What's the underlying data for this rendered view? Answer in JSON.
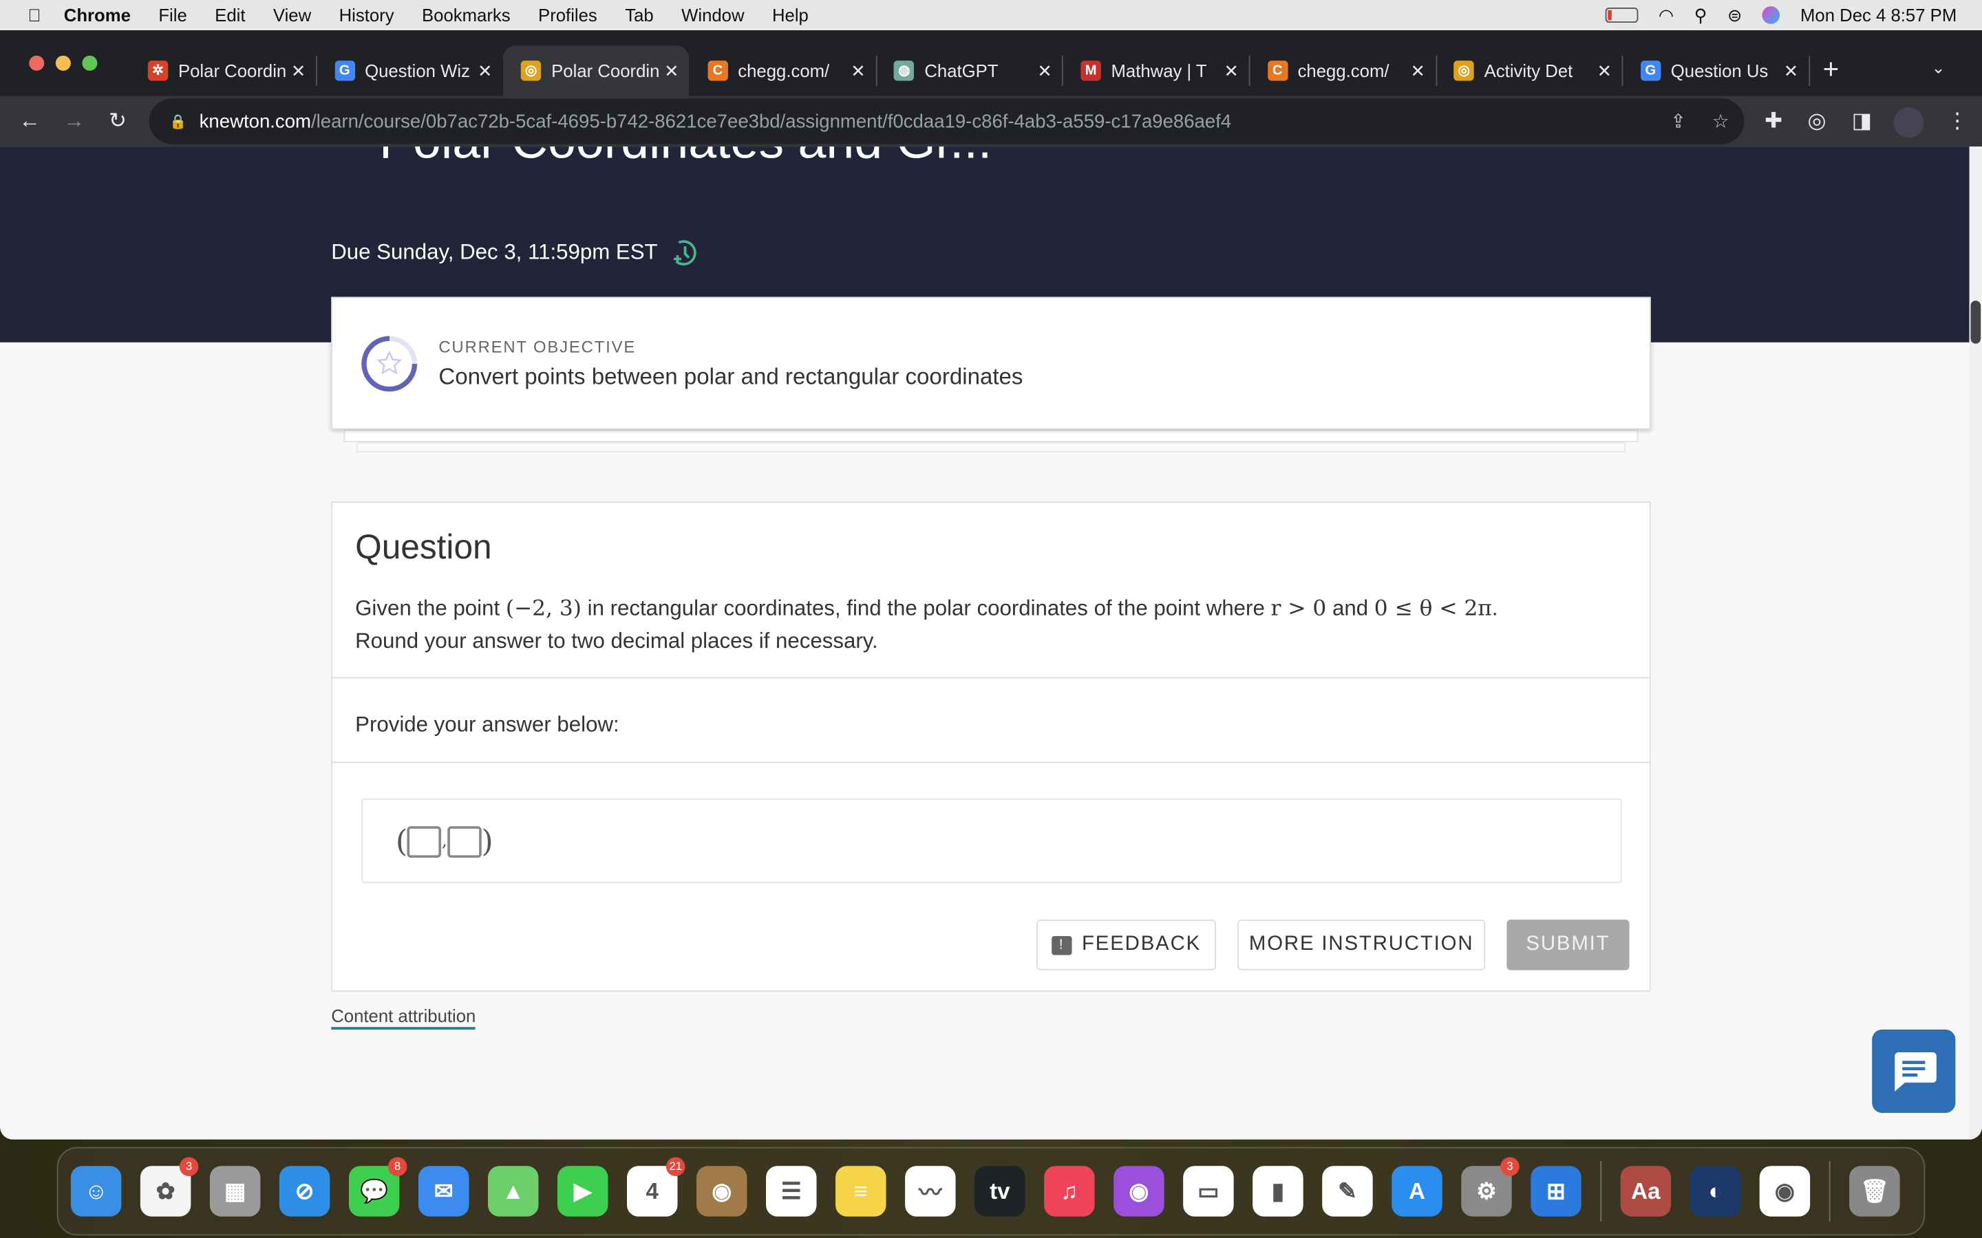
{
  "menubar": {
    "app": "Chrome",
    "items": [
      "File",
      "Edit",
      "View",
      "History",
      "Bookmarks",
      "Profiles",
      "Tab",
      "Window",
      "Help"
    ],
    "datetime": "Mon Dec 4  8:57 PM"
  },
  "tabs": [
    {
      "title": "Polar Coordinates",
      "color": "#d9402a",
      "glyph": "✲",
      "active": false
    },
    {
      "title": "Question Wiz",
      "color": "#4285f4",
      "glyph": "G",
      "active": false
    },
    {
      "title": "Polar Coordinates",
      "color": "#e0a020",
      "glyph": "◎",
      "active": true
    },
    {
      "title": "chegg.com/",
      "color": "#e87722",
      "glyph": "C",
      "active": false
    },
    {
      "title": "ChatGPT",
      "color": "#74aa9c",
      "glyph": "◍",
      "active": false
    },
    {
      "title": "Mathway | T",
      "color": "#c8312b",
      "glyph": "M",
      "active": false
    },
    {
      "title": "chegg.com/",
      "color": "#e87722",
      "glyph": "C",
      "active": false
    },
    {
      "title": "Activity Det",
      "color": "#e0a020",
      "glyph": "◎",
      "active": false
    },
    {
      "title": "Question Us",
      "color": "#4285f4",
      "glyph": "G",
      "active": false
    }
  ],
  "url": {
    "domain": "knewton.com",
    "path": "/learn/course/0b7ac72b-5caf-4695-b742-8621ce7ee3bd/assignment/f0cdaa19-c86f-4ab3-a559-c17a9e86aef4"
  },
  "header": {
    "title": "Polar Coordinates and Gr...",
    "due": "Due Sunday, Dec 3, 11:59pm EST"
  },
  "objective": {
    "label": "CURRENT OBJECTIVE",
    "text": "Convert points between polar and rectangular coordinates",
    "progress": 0.25
  },
  "question": {
    "title": "Question",
    "text_before": "Given the point ",
    "point": "(−2, 3)",
    "text_mid": " in rectangular coordinates, find the polar coordinates of the point where ",
    "cond1": "r > 0",
    "and": " and ",
    "cond2": "0 ≤ θ < 2π",
    "end": ".",
    "line2": "Round your answer to two decimal places if necessary.",
    "provide": "Provide your answer below:",
    "comma": ","
  },
  "buttons": {
    "feedback": "FEEDBACK",
    "more": "MORE INSTRUCTION",
    "submit": "SUBMIT"
  },
  "footer": {
    "attribution": "Content attribution"
  },
  "dock": [
    {
      "name": "Finder",
      "color": "#3a8ee6",
      "glyph": "☺"
    },
    {
      "name": "Photos",
      "color": "#f4f4f4",
      "glyph": "✿",
      "badge": "3"
    },
    {
      "name": "Launchpad",
      "color": "#9a9a9a",
      "glyph": "▦"
    },
    {
      "name": "Safari",
      "color": "#2f8fe8",
      "glyph": "⊘"
    },
    {
      "name": "Messages",
      "color": "#3ecf4f",
      "glyph": "💬",
      "badge": "8"
    },
    {
      "name": "Mail",
      "color": "#3b8bf0",
      "glyph": "✉"
    },
    {
      "name": "Maps",
      "color": "#6ccf6a",
      "glyph": "▲"
    },
    {
      "name": "FaceTime",
      "color": "#3ecf4f",
      "glyph": "▶"
    },
    {
      "name": "Calendar",
      "color": "#ffffff",
      "glyph": "4",
      "badge": "21"
    },
    {
      "name": "Contacts",
      "color": "#a07a48",
      "glyph": "◉"
    },
    {
      "name": "Reminders",
      "color": "#ffffff",
      "glyph": "☰"
    },
    {
      "name": "Notes",
      "color": "#f7d54a",
      "glyph": "≡"
    },
    {
      "name": "Freeform",
      "color": "#ffffff",
      "glyph": "〰"
    },
    {
      "name": "TV",
      "color": "#1e2426",
      "glyph": "tv"
    },
    {
      "name": "Music",
      "color": "#f0445a",
      "glyph": "♫"
    },
    {
      "name": "Podcasts",
      "color": "#9b4fdb",
      "glyph": "◉"
    },
    {
      "name": "Keynote",
      "color": "#ffffff",
      "glyph": "▭"
    },
    {
      "name": "Numbers",
      "color": "#ffffff",
      "glyph": "▮"
    },
    {
      "name": "Pages",
      "color": "#ffffff",
      "glyph": "✎"
    },
    {
      "name": "App Store",
      "color": "#2b8df0",
      "glyph": "A"
    },
    {
      "name": "System Settings",
      "color": "#8a8a8a",
      "glyph": "⚙",
      "badge": "3"
    },
    {
      "name": "Windows",
      "color": "#2a7ae0",
      "glyph": "⊞"
    },
    {
      "name": "Dictionary",
      "color": "#b04a44",
      "glyph": "Aa"
    },
    {
      "name": "Steam",
      "color": "#1b3a6b",
      "glyph": "◐"
    },
    {
      "name": "Chrome",
      "color": "#ffffff",
      "glyph": "◉"
    },
    {
      "name": "Trash",
      "color": "#888888",
      "glyph": "🗑"
    }
  ]
}
